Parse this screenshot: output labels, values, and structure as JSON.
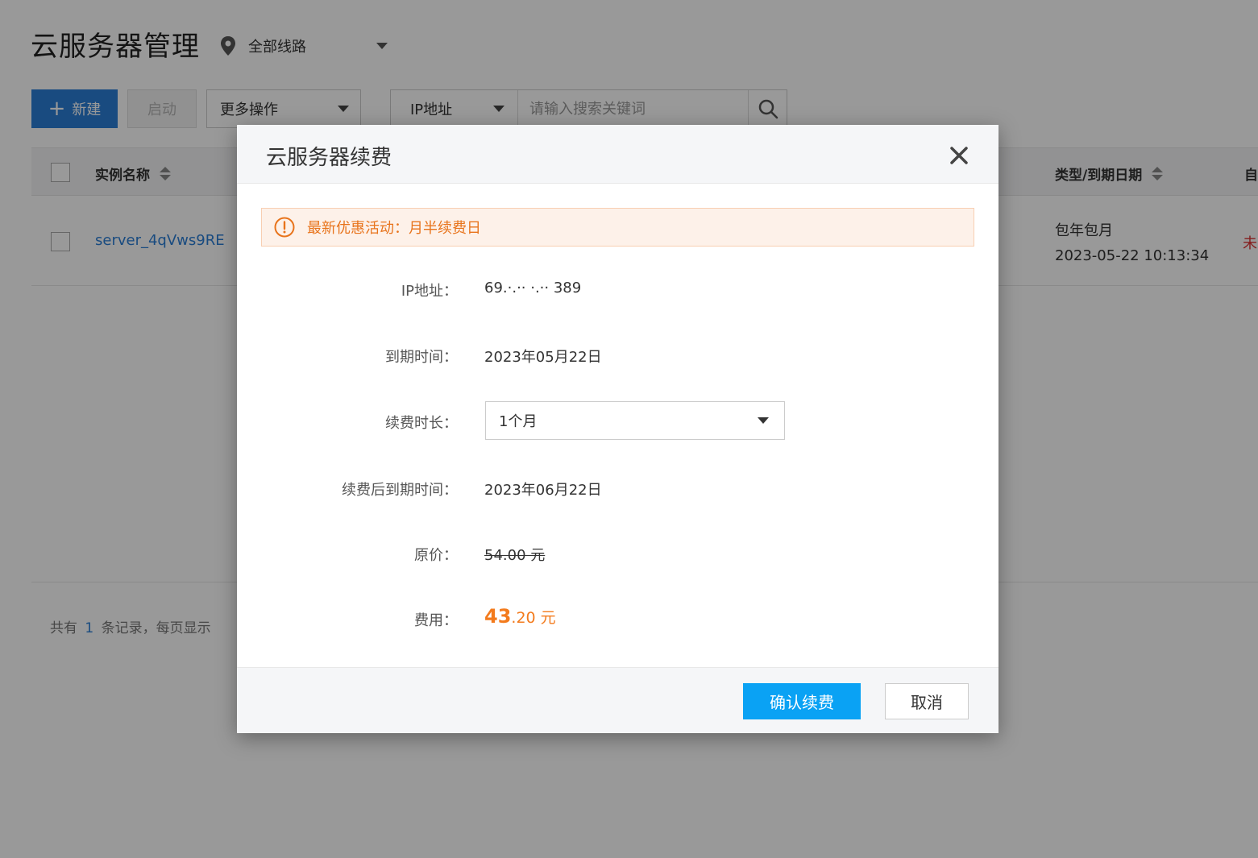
{
  "page": {
    "title": "云服务器管理",
    "region_selector": {
      "label": "全部线路"
    }
  },
  "toolbar": {
    "new_label": "新建",
    "start_label": "启动",
    "more_label": "更多操作",
    "search_type": "IP地址",
    "search_placeholder": "请输入搜索关键词"
  },
  "table": {
    "headers": {
      "name": "实例名称",
      "type_expiry": "类型/到期日期",
      "auto": "自"
    },
    "rows": [
      {
        "name": "server_4qVws9RE",
        "billing_type": "包年包月",
        "expiry": "2023-05-22 10:13:34",
        "status": "未"
      }
    ]
  },
  "pagination": {
    "prefix": "共有",
    "count": "1",
    "suffix": "条记录，每页显示"
  },
  "modal": {
    "title": "云服务器续费",
    "notice": "最新优惠活动：月半续费日",
    "fields": {
      "ip_label": "IP地址：",
      "ip_value": "69.·.·· ·.·· 389",
      "expiry_label": "到期时间：",
      "expiry_value": "2023年05月22日",
      "duration_label": "续费时长：",
      "duration_value": "1个月",
      "new_expiry_label": "续费后到期时间：",
      "new_expiry_value": "2023年06月22日",
      "original_price_label": "原价：",
      "original_price_value": "54.00 元",
      "fee_label": "费用：",
      "fee_integer": "43",
      "fee_decimal": ".20 元"
    },
    "confirm_label": "确认续费",
    "cancel_label": "取消"
  },
  "colors": {
    "brand_blue": "#2a7dd5",
    "confirm_blue": "#0aa2f4",
    "price_orange": "#f37b1d",
    "notice_bg": "#fdf1e9",
    "overlay": "rgba(0,0,0,0.4)"
  },
  "icons": {
    "region": "map-pin-icon",
    "new": "plus-icon",
    "search": "search-icon",
    "sort": "sort-icon",
    "close": "close-icon",
    "notice": "warning-circle-icon"
  }
}
